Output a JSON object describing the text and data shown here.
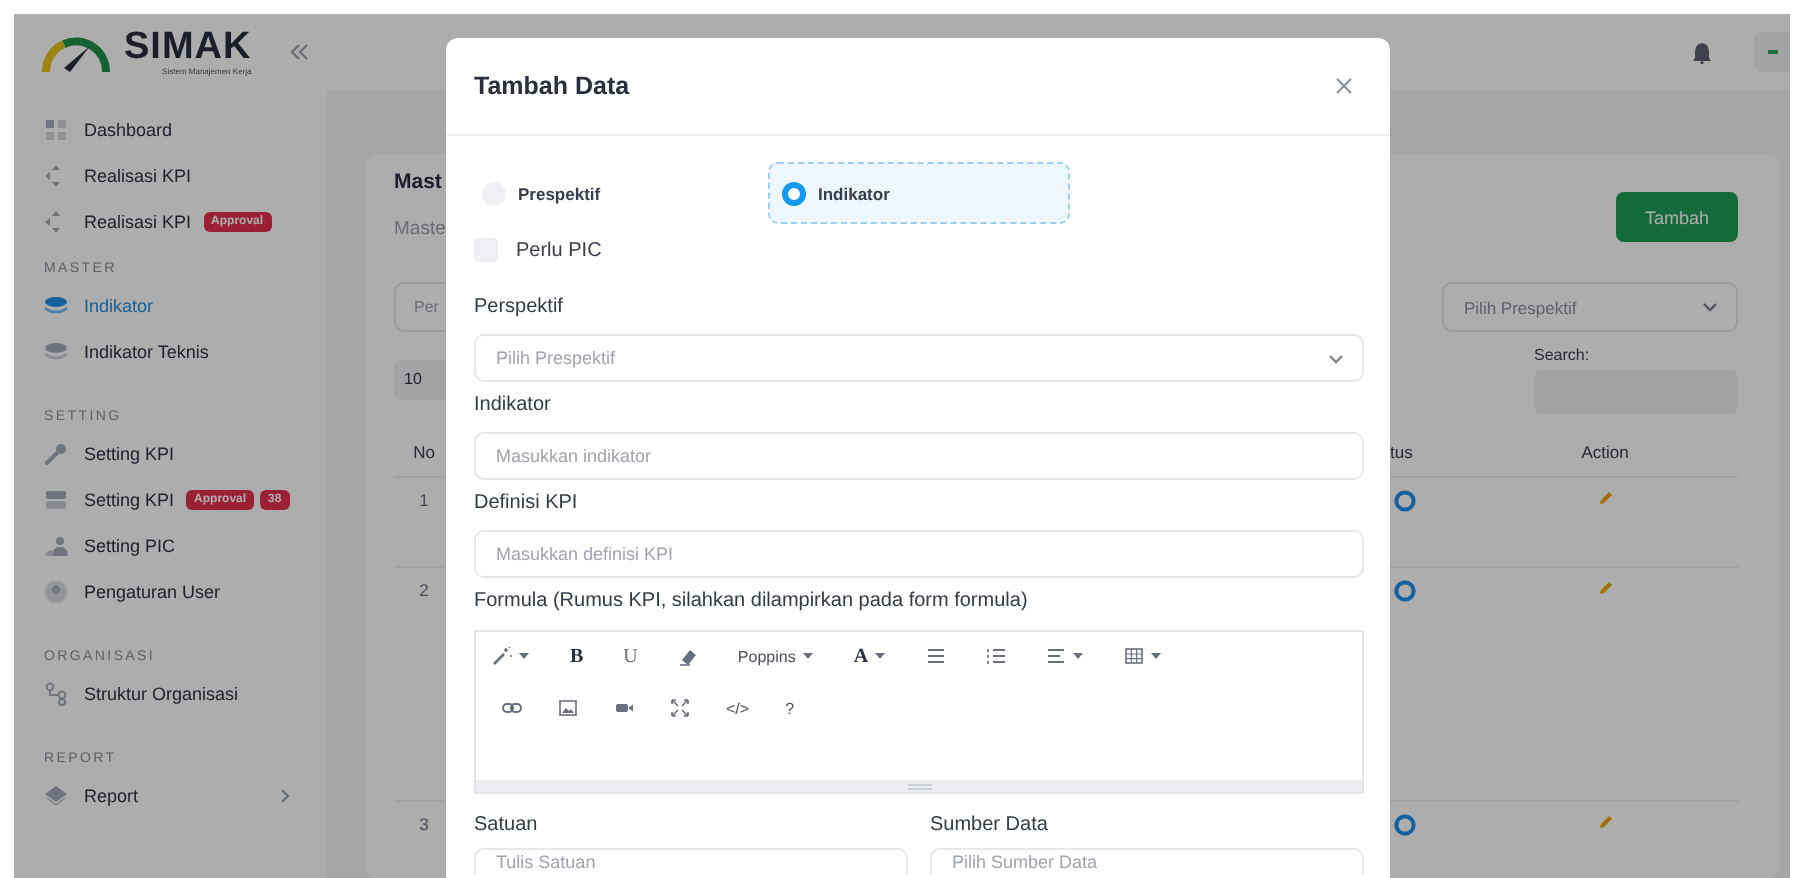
{
  "sidebar": {
    "logo": {
      "title": "SIMAK",
      "subtitle": "Sistem Manajemen Kerja"
    },
    "sections": [
      {
        "items": [
          {
            "label": "Dashboard",
            "selected": false,
            "expandable": false
          },
          {
            "label": "Realisasi KPI",
            "selected": false,
            "expandable": false
          },
          {
            "label": "Realisasi KPI",
            "selected": false,
            "expandable": false,
            "badges": [
              "Approval"
            ]
          }
        ]
      },
      {
        "heading": "MASTER",
        "items": [
          {
            "label": "Indikator",
            "selected": true,
            "expandable": false
          },
          {
            "label": "Indikator Teknis",
            "selected": false,
            "expandable": false
          }
        ]
      },
      {
        "heading": "SETTING",
        "items": [
          {
            "label": "Setting KPI",
            "selected": false,
            "expandable": false
          },
          {
            "label": "Setting KPI",
            "selected": false,
            "expandable": false,
            "badges": [
              "Approval",
              "38"
            ]
          },
          {
            "label": "Setting PIC",
            "selected": false,
            "expandable": false
          },
          {
            "label": "Pengaturan User",
            "selected": false,
            "expandable": false
          }
        ]
      },
      {
        "heading": "ORGANISASI",
        "items": [
          {
            "label": "Struktur Organisasi",
            "selected": false,
            "expandable": false
          }
        ]
      },
      {
        "heading": "REPORT",
        "items": [
          {
            "label": "Report",
            "selected": false,
            "expandable": true
          }
        ]
      }
    ]
  },
  "page": {
    "title": "Mast",
    "subtitle": "Maste",
    "filter_placeholder": "Per",
    "page_size": "10",
    "add_button": "Tambah",
    "perspective_filter": "Pilih Prespektif",
    "search_label": "Search:",
    "table": {
      "columns": [
        "No",
        "tus",
        "Action"
      ],
      "rows": [
        {
          "no": "1"
        },
        {
          "no": "2"
        },
        {
          "no": "3"
        }
      ]
    }
  },
  "modal": {
    "title": "Tambah Data",
    "type_options": [
      {
        "label": "Prespektif",
        "selected": false
      },
      {
        "label": "Indikator",
        "selected": true
      }
    ],
    "needs_pic": {
      "label": "Perlu PIC",
      "checked": false
    },
    "fields": [
      {
        "kind": "select",
        "label": "Perspektif",
        "placeholder": "Pilih Prespektif"
      },
      {
        "kind": "input",
        "label": "Indikator",
        "placeholder": "Masukkan indikator"
      },
      {
        "kind": "input",
        "label": "Definisi KPI",
        "placeholder": "Masukkan definisi KPI"
      },
      {
        "kind": "editor",
        "label": "Formula (Rumus KPI, silahkan dilampirkan pada form formula)",
        "toolbar_rows": [
          [
            {
              "kind": "wand",
              "dropdown": true
            },
            {
              "kind": "bold",
              "text": "B",
              "dropdown": false
            },
            {
              "kind": "underline",
              "text": "U",
              "dropdown": false
            },
            {
              "kind": "eraser",
              "dropdown": false
            },
            {
              "kind": "font",
              "text": "Poppins",
              "dropdown": true
            },
            {
              "kind": "color",
              "text": "A",
              "dropdown": true
            },
            {
              "kind": "list",
              "dropdown": false
            },
            {
              "kind": "numbered",
              "dropdown": false
            },
            {
              "kind": "align",
              "dropdown": true
            },
            {
              "kind": "table",
              "dropdown": true
            }
          ],
          [
            {
              "kind": "link",
              "dropdown": false
            },
            {
              "kind": "image",
              "dropdown": false
            },
            {
              "kind": "video",
              "dropdown": false
            },
            {
              "kind": "expand",
              "dropdown": false
            },
            {
              "kind": "code",
              "text": "</>",
              "dropdown": false
            },
            {
              "kind": "help",
              "text": "?",
              "dropdown": false
            }
          ]
        ]
      }
    ],
    "half_fields": [
      {
        "label": "Satuan",
        "placeholder": "Tulis Satuan"
      },
      {
        "label": "Sumber Data",
        "placeholder": "Pilih Sumber Data"
      }
    ]
  }
}
